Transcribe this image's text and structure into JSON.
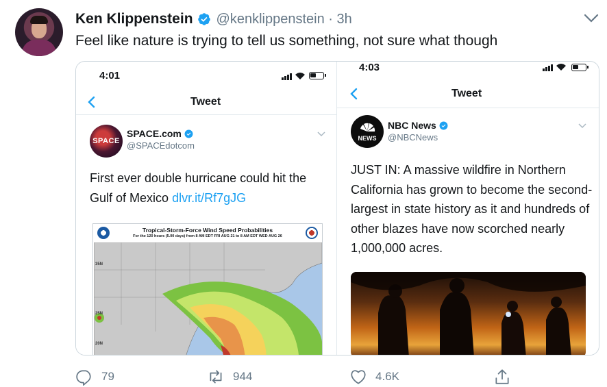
{
  "author": {
    "name": "Ken Klippenstein",
    "handle": "@kenklippenstein · 3h"
  },
  "tweet": {
    "text": "Feel like nature is trying to tell us something, not sure what though"
  },
  "left_screenshot": {
    "time": "4:01",
    "nav_title": "Tweet",
    "account_name": "SPACE.com",
    "account_handle": "@SPACEdotcom",
    "logo_text": "SPACE",
    "body_text": "First ever double hurricane could hit the Gulf of Mexico",
    "link": "dlvr.it/Rf7gJG",
    "map": {
      "title": "Tropical-Storm-Force Wind Speed Probabilities",
      "subtitle": "For the 120 hours (5.00 days) from 8 AM EDT FRI AUG 21 to 8 AM EDT WED AUG 26",
      "lat_35": "35N",
      "lat_25": "25N",
      "lat_20": "20N"
    }
  },
  "right_screenshot": {
    "time": "4:03",
    "nav_title": "Tweet",
    "account_name": "NBC News",
    "account_handle": "@NBCNews",
    "logo_text": "NEWS",
    "body_text": "JUST IN: A massive wildfire in Northern California has grown to become the second-largest in state history as it and hundreds of other blazes have now scorched nearly 1,000,000 acres."
  },
  "actions": {
    "replies": "79",
    "retweets": "944",
    "likes": "4.6K"
  },
  "colors": {
    "accent": "#1da1f2",
    "secondary_text": "#657786"
  },
  "icons": [
    "verified-badge-icon",
    "chevron-down-icon",
    "back-chevron-icon",
    "reply-icon",
    "retweet-icon",
    "like-icon",
    "share-icon"
  ]
}
